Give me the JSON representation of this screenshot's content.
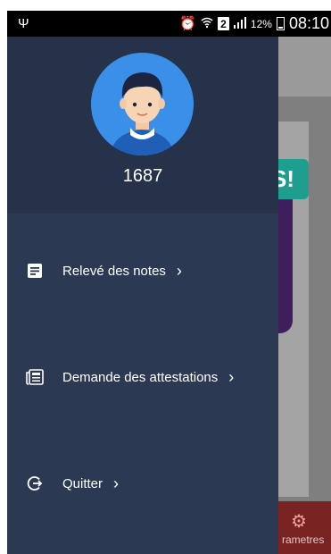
{
  "status_bar": {
    "battery_percent": "12%",
    "sim_slot": "2",
    "time": "08:10"
  },
  "background_app": {
    "badge_text": "S!",
    "bottom_tab_label": "rametres"
  },
  "drawer": {
    "username": "1687",
    "menu": [
      {
        "label": "Relevé des notes",
        "icon": "document-icon"
      },
      {
        "label": "Demande des attestations",
        "icon": "newspaper-icon"
      },
      {
        "label": "Quitter",
        "icon": "logout-icon"
      }
    ]
  },
  "colors": {
    "drawer_bg": "#2b3a52",
    "drawer_header_bg": "#25324a",
    "avatar_bg": "#3a8fe8"
  }
}
